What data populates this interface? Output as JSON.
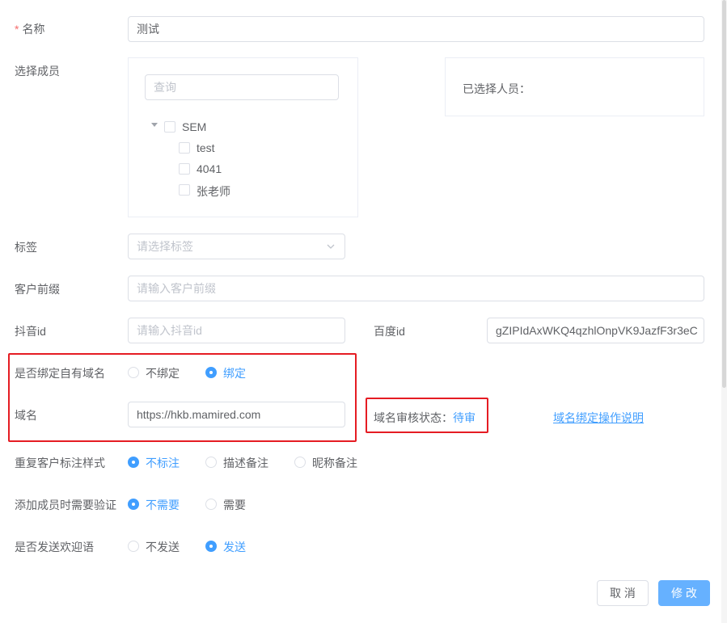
{
  "form": {
    "name": {
      "required_mark": "*",
      "label": "名称",
      "value": "测试"
    },
    "members": {
      "label": "选择成员",
      "search_placeholder": "查询",
      "tree": {
        "root": "SEM",
        "children": [
          "test",
          "4041",
          "张老师"
        ]
      },
      "selected_label": "已选择人员："
    },
    "tags": {
      "label": "标签",
      "placeholder": "请选择标签"
    },
    "prefix": {
      "label": "客户前缀",
      "placeholder": "请输入客户前缀"
    },
    "douyin": {
      "label": "抖音id",
      "placeholder": "请输入抖音id"
    },
    "baidu": {
      "label": "百度id",
      "value": "gZIPIdAxWKQ4qzhlOnpVK9JazfF3r3eC"
    },
    "bind_domain": {
      "label": "是否绑定自有域名",
      "options": [
        "不绑定",
        "绑定"
      ],
      "selected": "绑定"
    },
    "domain": {
      "label": "域名",
      "value": "https://hkb.mamired.com"
    },
    "review": {
      "label": "域名审核状态：",
      "value": "待审"
    },
    "guide_link": "域名绑定操作说明",
    "repeat_style": {
      "label": "重复客户标注样式",
      "options": [
        "不标注",
        "描述备注",
        "昵称备注"
      ],
      "selected": "不标注"
    },
    "verify": {
      "label": "添加成员时需要验证",
      "options": [
        "不需要",
        "需要"
      ],
      "selected": "不需要"
    },
    "welcome": {
      "label": "是否发送欢迎语",
      "options": [
        "不发送",
        "发送"
      ],
      "selected": "发送"
    }
  },
  "footer": {
    "cancel": "取 消",
    "submit": "修 改"
  },
  "colors": {
    "primary": "#409eff",
    "highlight_border": "#e51c23",
    "required": "#f56c6c"
  }
}
